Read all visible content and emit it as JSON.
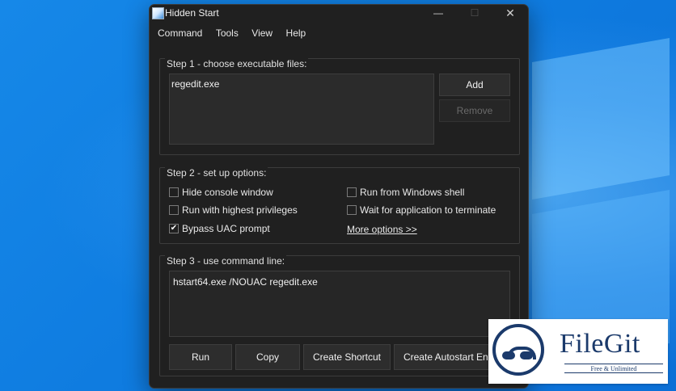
{
  "window": {
    "title": "Hidden Start",
    "controls": {
      "minimize": "—",
      "maximize": "☐",
      "close": "✕"
    }
  },
  "menu": [
    "Command",
    "Tools",
    "View",
    "Help"
  ],
  "step1": {
    "title": "Step 1 - choose executable files:",
    "files": [
      "regedit.exe"
    ],
    "add_label": "Add",
    "remove_label": "Remove"
  },
  "step2": {
    "title": "Step 2 - set up options:",
    "options": [
      {
        "label": "Hide console window",
        "checked": false
      },
      {
        "label": "Run with highest privileges",
        "checked": false
      },
      {
        "label": "Bypass UAC prompt",
        "checked": true
      },
      {
        "label": "Run from Windows shell",
        "checked": false
      },
      {
        "label": "Wait for application to terminate",
        "checked": false
      }
    ],
    "more_options": "More options >>"
  },
  "step3": {
    "title": "Step 3 - use command line:",
    "command": "hstart64.exe /NOUAC regedit.exe",
    "buttons": [
      "Run",
      "Copy",
      "Create Shortcut",
      "Create Autostart Entry"
    ]
  },
  "watermark": {
    "name": "FileGit",
    "tagline": "Free & Unlimited"
  },
  "colors": {
    "window_bg": "#202020",
    "desktop_blue": "#0f7ce0",
    "watermark_navy": "#1b3a6b"
  }
}
